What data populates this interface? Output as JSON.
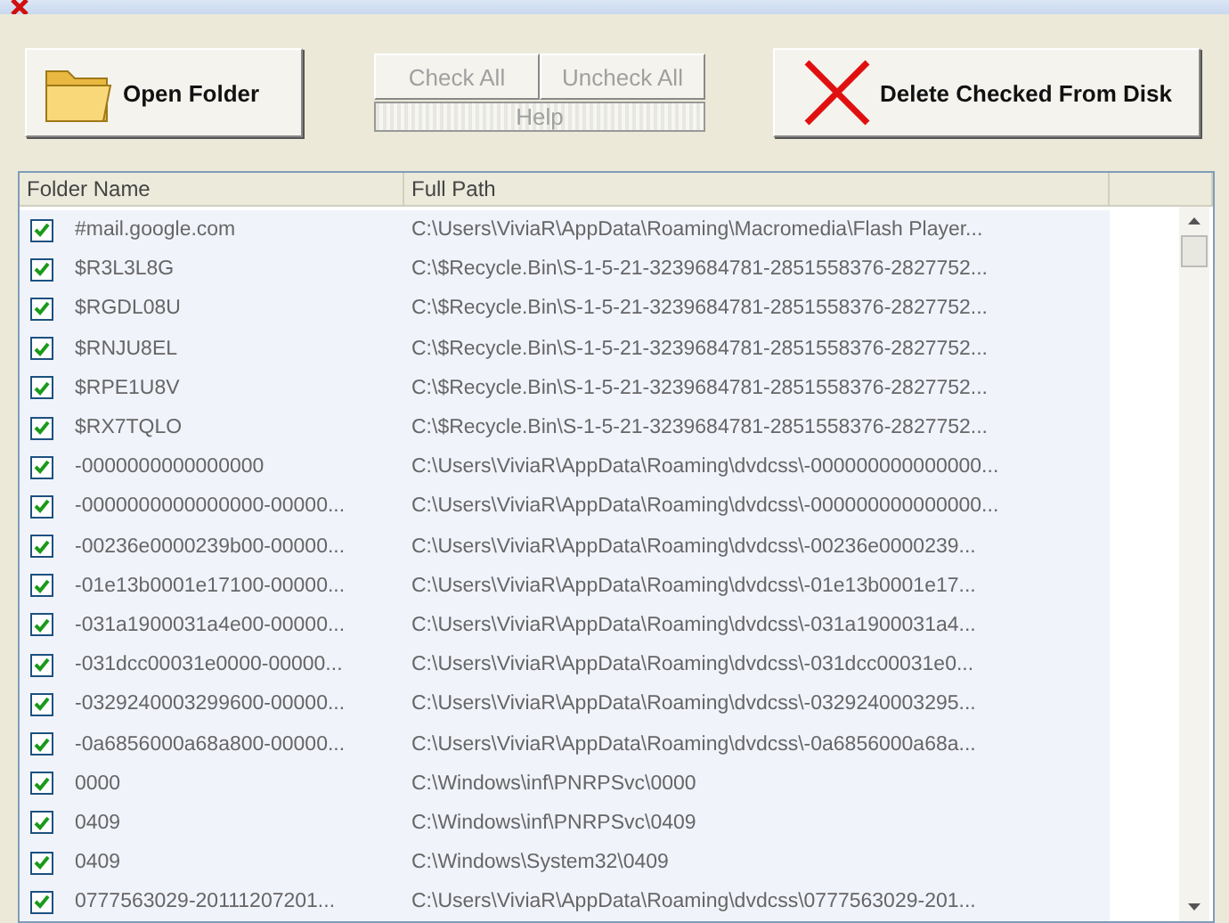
{
  "toolbar": {
    "open_button": "Open Folder",
    "check_all": {
      "label": "Check All",
      "disabled": true
    },
    "uncheck_all": {
      "label": "Uncheck All",
      "disabled": true
    },
    "help": {
      "label": "Help",
      "disabled": true
    },
    "delete_button": "Delete Checked From Disk"
  },
  "table": {
    "columns": [
      "Folder Name",
      "Full Path"
    ],
    "rows": [
      {
        "name": "#mail.google.com",
        "path": "C:\\Users\\ViviaR\\AppData\\Roaming\\Macromedia\\Flash Player...",
        "checked": true
      },
      {
        "name": "$R3L3L8G",
        "path": "C:\\$Recycle.Bin\\S-1-5-21-3239684781-2851558376-2827752...",
        "checked": true
      },
      {
        "name": "$RGDL08U",
        "path": "C:\\$Recycle.Bin\\S-1-5-21-3239684781-2851558376-2827752...",
        "checked": true
      },
      {
        "name": "$RNJU8EL",
        "path": "C:\\$Recycle.Bin\\S-1-5-21-3239684781-2851558376-2827752...",
        "checked": true
      },
      {
        "name": "$RPE1U8V",
        "path": "C:\\$Recycle.Bin\\S-1-5-21-3239684781-2851558376-2827752...",
        "checked": true
      },
      {
        "name": "$RX7TQLO",
        "path": "C:\\$Recycle.Bin\\S-1-5-21-3239684781-2851558376-2827752...",
        "checked": true
      },
      {
        "name": "-0000000000000000",
        "path": "C:\\Users\\ViviaR\\AppData\\Roaming\\dvdcss\\-000000000000000...",
        "checked": true
      },
      {
        "name": "-0000000000000000-00000...",
        "path": "C:\\Users\\ViviaR\\AppData\\Roaming\\dvdcss\\-000000000000000...",
        "checked": true
      },
      {
        "name": "-00236e0000239b00-00000...",
        "path": "C:\\Users\\ViviaR\\AppData\\Roaming\\dvdcss\\-00236e0000239...",
        "checked": true
      },
      {
        "name": "-01e13b0001e17100-00000...",
        "path": "C:\\Users\\ViviaR\\AppData\\Roaming\\dvdcss\\-01e13b0001e17...",
        "checked": true
      },
      {
        "name": "-031a1900031a4e00-00000...",
        "path": "C:\\Users\\ViviaR\\AppData\\Roaming\\dvdcss\\-031a1900031a4...",
        "checked": true
      },
      {
        "name": "-031dcc00031e0000-00000...",
        "path": "C:\\Users\\ViviaR\\AppData\\Roaming\\dvdcss\\-031dcc00031e0...",
        "checked": true
      },
      {
        "name": "-0329240003299600-00000...",
        "path": "C:\\Users\\ViviaR\\AppData\\Roaming\\dvdcss\\-0329240003295...",
        "checked": true
      },
      {
        "name": "-0a6856000a68a800-00000...",
        "path": "C:\\Users\\ViviaR\\AppData\\Roaming\\dvdcss\\-0a6856000a68a...",
        "checked": true
      },
      {
        "name": "0000",
        "path": "C:\\Windows\\inf\\PNRPSvc\\0000",
        "checked": true
      },
      {
        "name": "0409",
        "path": "C:\\Windows\\inf\\PNRPSvc\\0409",
        "checked": true
      },
      {
        "name": "0409",
        "path": "C:\\Windows\\System32\\0409",
        "checked": true
      },
      {
        "name": "0777563029-20111207201...",
        "path": "C:\\Users\\ViviaR\\AppData\\Roaming\\dvdcss\\0777563029-201...",
        "checked": true
      }
    ]
  }
}
